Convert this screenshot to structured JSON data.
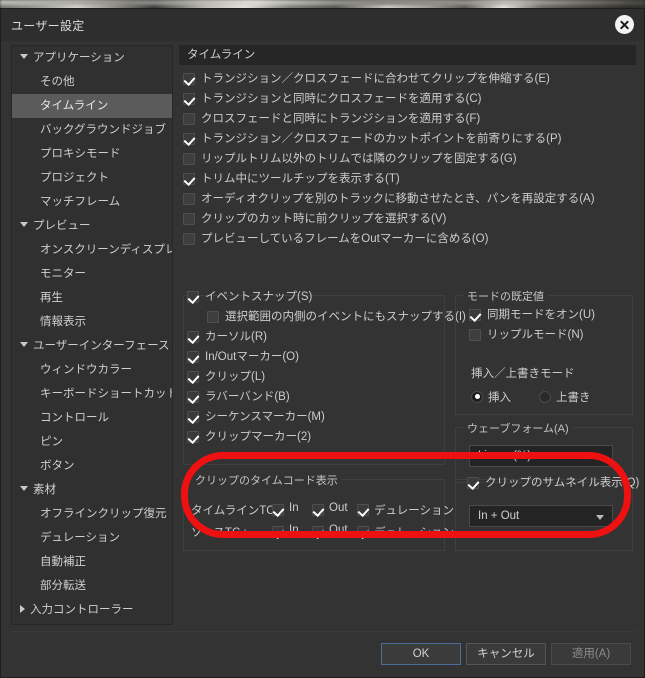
{
  "window": {
    "title": "ユーザー設定",
    "close_icon": "close-circle-icon"
  },
  "sidebar": {
    "items": [
      {
        "label": "アプリケーション",
        "type": "group",
        "expanded": true
      },
      {
        "label": "その他",
        "type": "child"
      },
      {
        "label": "タイムライン",
        "type": "child",
        "selected": true
      },
      {
        "label": "バックグラウンドジョブ",
        "type": "child"
      },
      {
        "label": "プロキシモード",
        "type": "child"
      },
      {
        "label": "プロジェクト",
        "type": "child"
      },
      {
        "label": "マッチフレーム",
        "type": "child"
      },
      {
        "label": "プレビュー",
        "type": "group",
        "expanded": true
      },
      {
        "label": "オンスクリーンディスプレイ",
        "type": "child"
      },
      {
        "label": "モニター",
        "type": "child"
      },
      {
        "label": "再生",
        "type": "child"
      },
      {
        "label": "情報表示",
        "type": "child"
      },
      {
        "label": "ユーザーインターフェース",
        "type": "group",
        "expanded": true
      },
      {
        "label": "ウィンドウカラー",
        "type": "child"
      },
      {
        "label": "キーボードショートカット",
        "type": "child"
      },
      {
        "label": "コントロール",
        "type": "child"
      },
      {
        "label": "ピン",
        "type": "child"
      },
      {
        "label": "ボタン",
        "type": "child"
      },
      {
        "label": "素材",
        "type": "group",
        "expanded": true
      },
      {
        "label": "オフラインクリップ復元",
        "type": "child"
      },
      {
        "label": "デュレーション",
        "type": "child"
      },
      {
        "label": "自動補正",
        "type": "child"
      },
      {
        "label": "部分転送",
        "type": "child"
      },
      {
        "label": "入力コントローラー",
        "type": "group",
        "expanded": false
      }
    ]
  },
  "pane": {
    "header": "タイムライン",
    "checkboxes": [
      {
        "label": "トランジション／クロスフェードに合わせてクリップを伸縮する(E)",
        "checked": true
      },
      {
        "label": "トランジションと同時にクロスフェードを適用する(C)",
        "checked": true
      },
      {
        "label": "クロスフェードと同時にトランジションを適用する(F)",
        "checked": false
      },
      {
        "label": "トランジション／クロスフェードのカットポイントを前寄りにする(P)",
        "checked": true
      },
      {
        "label": "リップルトリム以外のトリムでは隣のクリップを固定する(G)",
        "checked": false
      },
      {
        "label": "トリム中にツールチップを表示する(T)",
        "checked": true
      },
      {
        "label": "オーディオクリップを別のトラックに移動させたとき、パンを再設定する(A)",
        "checked": false
      },
      {
        "label": "クリップのカット時に前クリップを選択する(V)",
        "checked": false
      },
      {
        "label": "プレビューしているフレームをOutマーカーに含める(O)",
        "checked": false
      }
    ],
    "snap_group": {
      "title": "イベントスナップ(S)",
      "title_checked": true,
      "items": [
        {
          "label": "選択範囲の内側のイベントにもスナップする(I)",
          "checked": false,
          "indent": true
        },
        {
          "label": "カーソル(R)",
          "checked": true,
          "indent": false
        },
        {
          "label": "In/Outマーカー(O)",
          "checked": true,
          "indent": false
        },
        {
          "label": "クリップ(L)",
          "checked": true,
          "indent": false
        },
        {
          "label": "ラバーバンド(B)",
          "checked": true,
          "indent": false
        },
        {
          "label": "シーケンスマーカー(M)",
          "checked": true,
          "indent": false
        },
        {
          "label": "クリップマーカー(2)",
          "checked": true,
          "indent": false
        }
      ]
    },
    "mode_defaults": {
      "title": "モードの既定値",
      "checkboxes": [
        {
          "label": "同期モードをオン(U)",
          "checked": true
        },
        {
          "label": "リップルモード(N)",
          "checked": false
        }
      ],
      "insert_label": "挿入／上書きモード",
      "radios": [
        {
          "label": "挿入",
          "selected": true
        },
        {
          "label": "上書き",
          "selected": false
        }
      ]
    },
    "waveform": {
      "title": "ウェーブフォーム(A)",
      "value": "Linear (%)"
    },
    "timecode_group": {
      "title": "クリップのタイムコード表示",
      "rows": [
        {
          "label": "タイムラインTC:",
          "options": [
            {
              "label": "In",
              "checked": true
            },
            {
              "label": "Out",
              "checked": true
            },
            {
              "label": "デュレーション",
              "checked": true
            }
          ]
        },
        {
          "label": "ソースTC :",
          "options": [
            {
              "label": "In",
              "checked": true
            },
            {
              "label": "Out",
              "checked": true
            },
            {
              "label": "デュレーション",
              "checked": true
            }
          ]
        }
      ]
    },
    "thumbnail_group": {
      "checkbox": {
        "label": "クリップのサムネイル表示(Q)",
        "checked": true
      },
      "dropdown_value": "In + Out"
    }
  },
  "annotation": {
    "shape": "red-oval-highlight",
    "color": "#ee1111"
  },
  "footer": {
    "buttons": [
      {
        "label": "OK",
        "style": "primary"
      },
      {
        "label": "キャンセル",
        "style": "normal"
      },
      {
        "label": "適用(A)",
        "style": "disabled"
      }
    ]
  }
}
